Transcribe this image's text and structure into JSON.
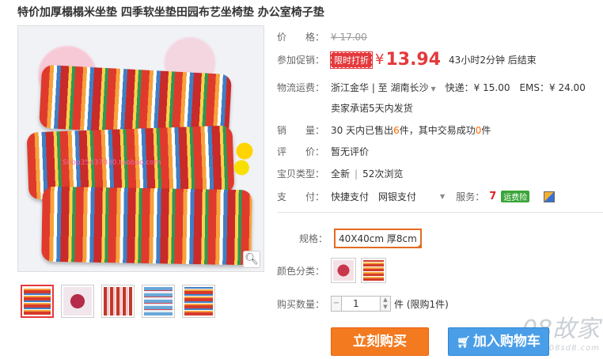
{
  "product": {
    "title": "特价加厚榻榻米坐垫 四季软坐垫田园布艺坐椅垫 办公室椅子垫"
  },
  "gallery": {
    "watermark": "Shop35437030.taobao.com",
    "zoom_icon": "magnifier-icon",
    "thumb_count": 5
  },
  "price": {
    "label": "价　　格：",
    "original": "¥ 17.00"
  },
  "promo": {
    "label": "参加促销：",
    "badge": "限时打折",
    "currency": "¥",
    "price": "13.94",
    "countdown": "43小时2分钟 后结束"
  },
  "shipping": {
    "label": "物流运费：",
    "route": "浙江金华 | 至 湖南长沙",
    "express": "快递：¥ 15.00",
    "ems": "EMS：¥ 24.00",
    "promise": "卖家承诺5天内发货"
  },
  "sales": {
    "label": "销　　量：",
    "prefix": "30 天内已售出 ",
    "sold": "6",
    "middle": " 件，其中交易成功 ",
    "success": "0",
    "suffix": " 件"
  },
  "rating": {
    "label": "评　　价：",
    "value": "暂无评价"
  },
  "item_type": {
    "label": "宝贝类型：",
    "condition": "全新",
    "views": "52次浏览"
  },
  "payment": {
    "label": "支　　付：",
    "method1": "快捷支付",
    "method2": "网银支付",
    "service_label": "服务：",
    "service_badge": "运费险"
  },
  "spec": {
    "label": "规格：",
    "selected": "40X40cm 厚8cm"
  },
  "color": {
    "label": "颜色分类："
  },
  "quantity": {
    "label": "购买数量：",
    "value": "1",
    "unit": "件 (限购1件)"
  },
  "actions": {
    "buy": "立刻购买",
    "cart": "加入购物车"
  },
  "site_watermark": {
    "text": "08故家",
    "sub": "www.08sd8.com"
  },
  "colors": {
    "accent_red": "#e4393c",
    "buy_orange": "#f47a20",
    "cart_blue": "#4a9ee8"
  }
}
